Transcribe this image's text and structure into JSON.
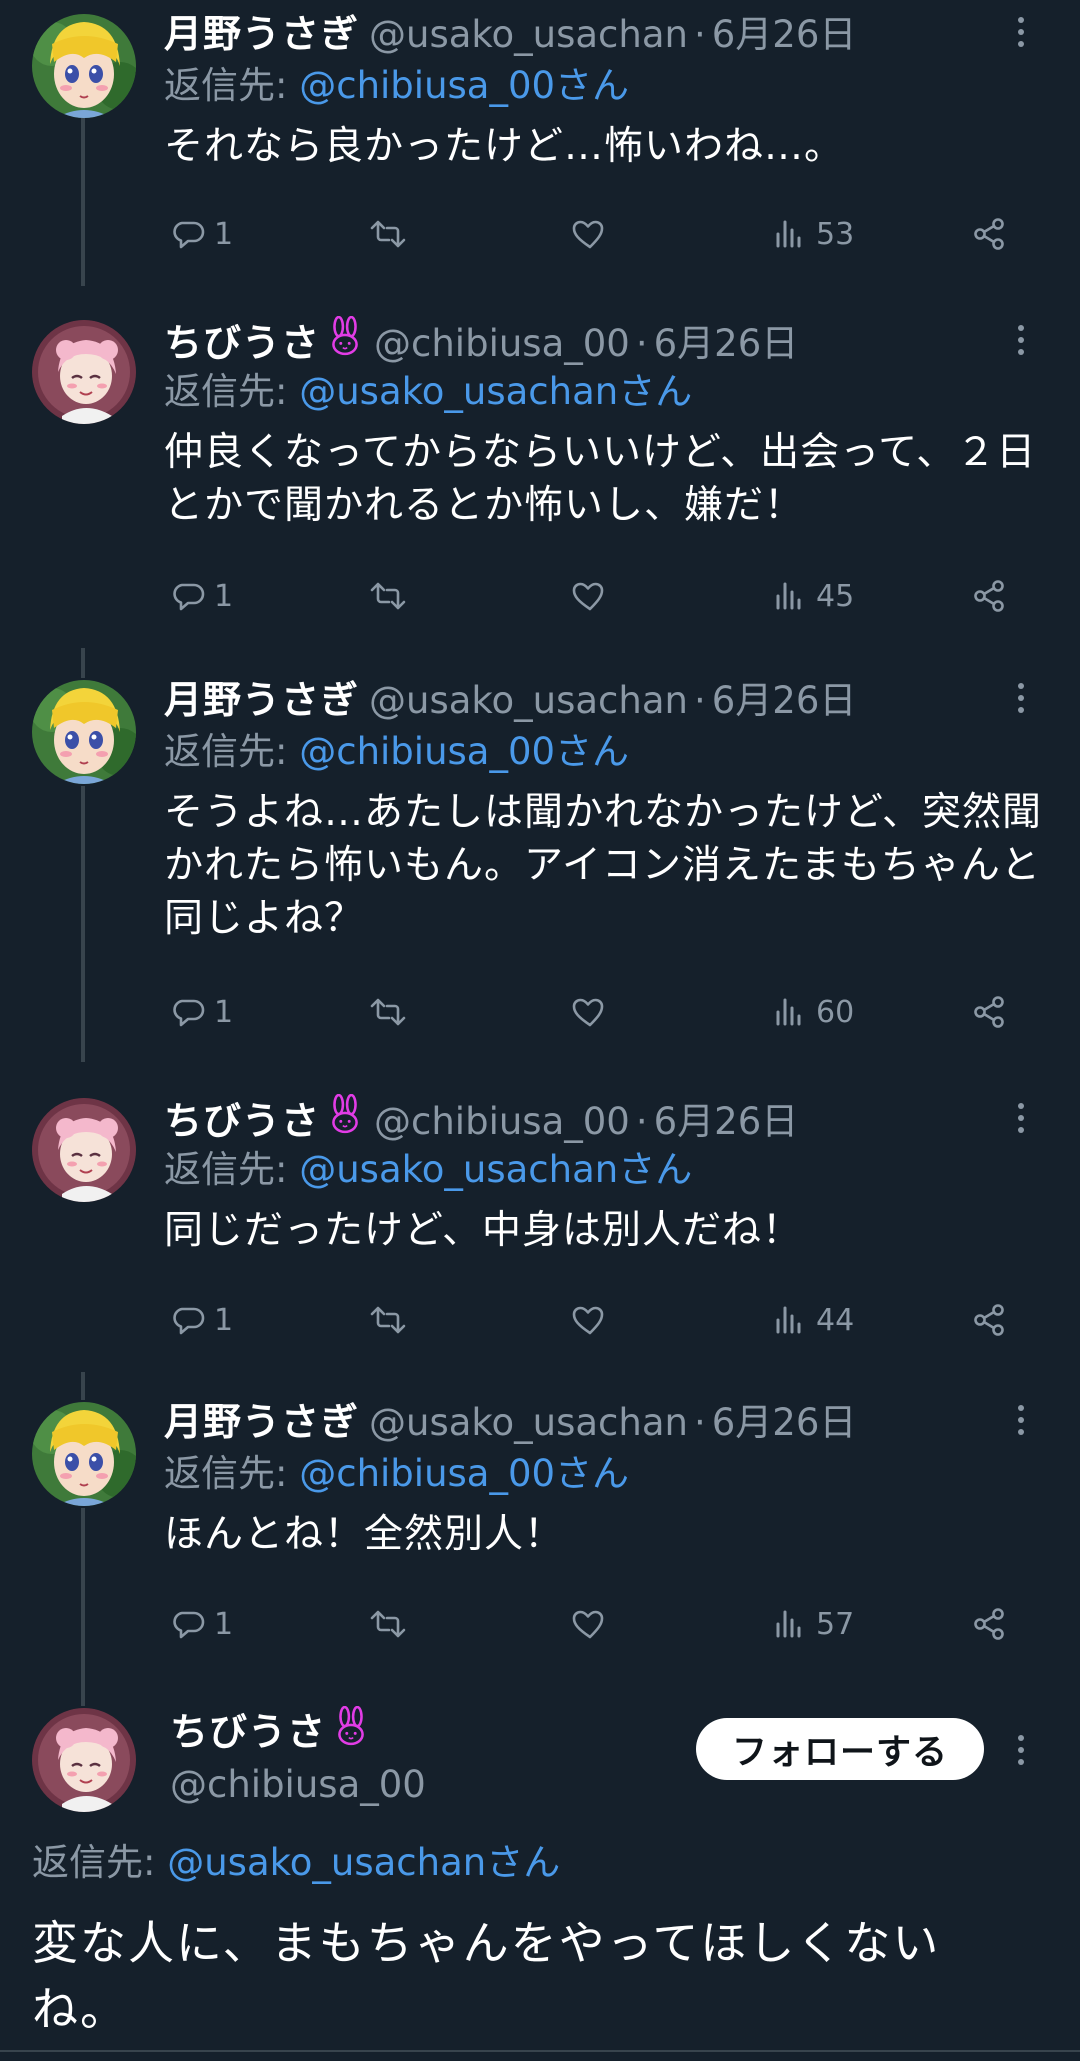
{
  "tweets": [
    {
      "name": "月野うさぎ",
      "handle": "@usako_usachan",
      "separator": "·",
      "date": "6月26日",
      "reply_prefix": "返信先:",
      "reply_to": "@chibiusa_00さん",
      "text": "それなら良かったけど…怖いわね…。",
      "replies": "1",
      "views": "53"
    },
    {
      "name": "ちびうさ",
      "handle": "@chibiusa_00",
      "separator": "·",
      "date": "6月26日",
      "reply_prefix": "返信先:",
      "reply_to": "@usako_usachanさん",
      "text": "仲良くなってからならいいけど、出会って、２日とかで聞かれるとか怖いし、嫌だ！",
      "replies": "1",
      "views": "45"
    },
    {
      "name": "月野うさぎ",
      "handle": "@usako_usachan",
      "separator": "·",
      "date": "6月26日",
      "reply_prefix": "返信先:",
      "reply_to": "@chibiusa_00さん",
      "text": "そうよね…あたしは聞かれなかったけど、突然聞かれたら怖いもん。アイコン消えたまもちゃんと同じよね？",
      "replies": "1",
      "views": "60"
    },
    {
      "name": "ちびうさ",
      "handle": "@chibiusa_00",
      "separator": "·",
      "date": "6月26日",
      "reply_prefix": "返信先:",
      "reply_to": "@usako_usachanさん",
      "text": "同じだったけど、中身は別人だね！",
      "replies": "1",
      "views": "44"
    },
    {
      "name": "月野うさぎ",
      "handle": "@usako_usachan",
      "separator": "·",
      "date": "6月26日",
      "reply_prefix": "返信先:",
      "reply_to": "@chibiusa_00さん",
      "text": "ほんとね！全然別人！",
      "replies": "1",
      "views": "57"
    }
  ],
  "focused_tweet": {
    "name": "ちびうさ",
    "handle": "@chibiusa_00",
    "follow_label": "フォローする",
    "reply_prefix": "返信先:",
    "reply_to": "@usako_usachanさん",
    "text": "変な人に、まもちゃんをやってほしくないね。"
  },
  "icons": {
    "reply": "comment-icon",
    "retweet": "retweet-icon",
    "like": "heart-icon",
    "views": "analytics-icon",
    "share": "share-icon",
    "more": "more-vertical-icon",
    "badge": "rabbit-emoji-icon"
  },
  "colors": {
    "background": "#15202b",
    "text": "#ffffff",
    "secondary": "#8b98a5",
    "link": "#4a99e9",
    "divider": "#38444d",
    "rabbit": "#e23ce6"
  }
}
